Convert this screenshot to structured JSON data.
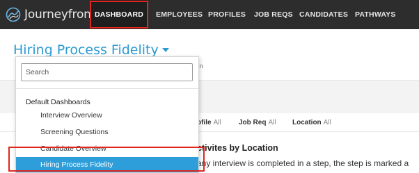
{
  "brand": {
    "name": "Journeyfront"
  },
  "nav": {
    "items": [
      {
        "label": "DASHBOARD",
        "active": true
      },
      {
        "label": "EMPLOYEES",
        "active": false
      },
      {
        "label": "PROFILES",
        "active": false
      },
      {
        "label": "JOB REQS",
        "active": false
      },
      {
        "label": "CANDIDATES",
        "active": false
      },
      {
        "label": "PATHWAYS",
        "active": false
      }
    ]
  },
  "header": {
    "title": "Hiring Process Fidelity",
    "subtext": "fflin"
  },
  "filters": [
    {
      "label": "ofile",
      "value": "All"
    },
    {
      "label": "Job Req",
      "value": "All"
    },
    {
      "label": "Location",
      "value": "All"
    }
  ],
  "content": {
    "section_title": "ctivites by Location",
    "body_text": "any interview is completed in a step, the step is marked a"
  },
  "dropdown": {
    "search_placeholder": "Search",
    "group_label": "Default Dashboards",
    "items": [
      {
        "label": "Interview Overview",
        "selected": false
      },
      {
        "label": "Screening Questions",
        "selected": false
      },
      {
        "label": "Candidate Overview",
        "selected": false
      },
      {
        "label": "Hiring Process Fidelity",
        "selected": true
      }
    ]
  },
  "colors": {
    "nav_bg": "#2d2d2d",
    "accent": "#2b9ad3",
    "selected_bg": "#2d9ed9",
    "annotation": "#e0261e"
  },
  "icons": {
    "logo": "journeyfront-logo-icon",
    "dropdown_caret": "caret-down-icon"
  }
}
